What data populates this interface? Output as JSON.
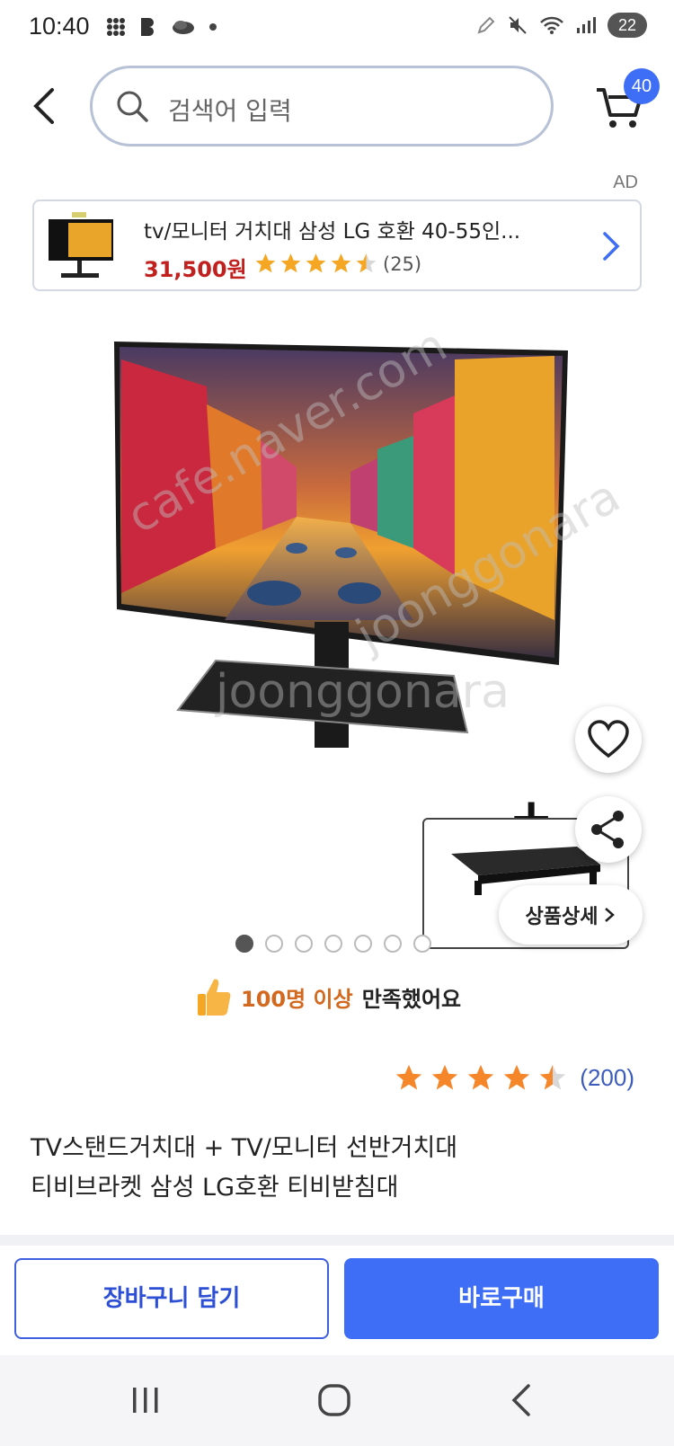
{
  "status_bar": {
    "time": "10:40",
    "battery": "22",
    "icons": [
      "grid-dots-icon",
      "b-app-icon",
      "cloud-icon",
      "dot-icon",
      "pen-icon",
      "mute-icon",
      "wifi-icon",
      "signal-icon"
    ]
  },
  "search": {
    "placeholder": "검색어 입력"
  },
  "cart": {
    "badge": "40"
  },
  "ad": {
    "tag": "AD",
    "title": "tv/모니터 거치대 삼성 LG 호환 40-55인...",
    "price": "31,500원",
    "rating": 4.5,
    "count": "(25)"
  },
  "product_image": {
    "watermark1": "cafe.naver.com",
    "watermark2": "joonggonara",
    "watermark3": "joonggonara"
  },
  "detail_button": {
    "label": "상품상세"
  },
  "carousel": {
    "total": 7,
    "active": 1
  },
  "satisfaction": {
    "strong": "100명 이상",
    "rest": "만족했어요"
  },
  "reviews": {
    "rating": 4.5,
    "count": "(200)"
  },
  "product": {
    "title_line1": "TV스탠드거치대 + TV/모니터 선반거치대",
    "title_line2": "티비브라켓 삼성 LG호환 티비받침대"
  },
  "actions": {
    "add_to_cart": "장바구니 담기",
    "buy_now": "바로구매"
  },
  "colors": {
    "accent": "#3d6ef5",
    "price": "#c0201e",
    "star": "#f5a623",
    "satisfaction": "#d2691e"
  }
}
